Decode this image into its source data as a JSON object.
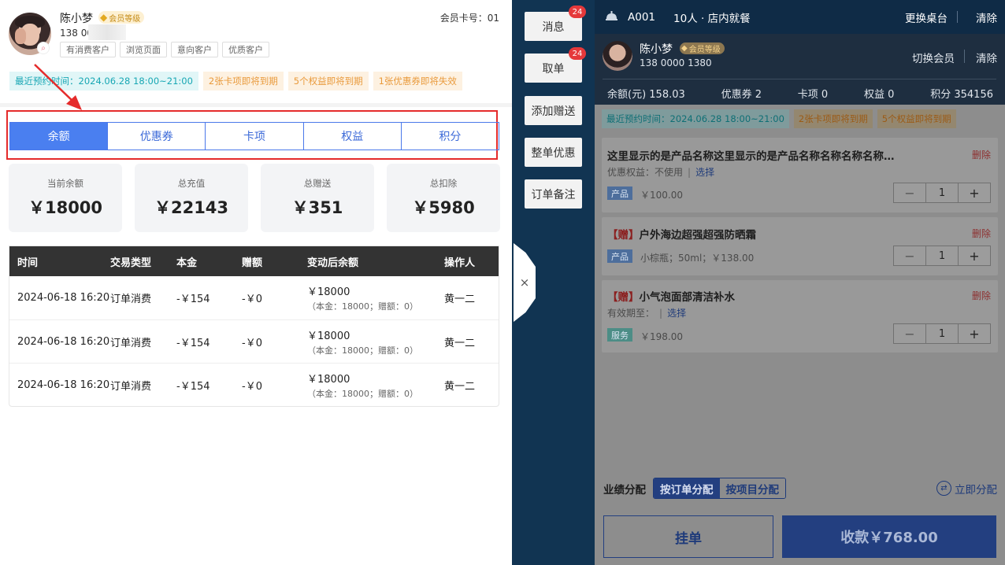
{
  "member": {
    "name": "陈小梦",
    "badge": "会员等级",
    "phone_prefix": "138 00",
    "card_label": "会员卡号：01",
    "tags": [
      "有消费客户",
      "浏览页面",
      "意向客户",
      "优质客户"
    ],
    "notices": [
      "最近预约时间：2024.06.28 18:00~21:00",
      "2张卡项即将到期",
      "5个权益即将到期",
      "1张优惠券即将失效"
    ]
  },
  "tabs": [
    {
      "label": "余额",
      "active": true
    },
    {
      "label": "优惠券",
      "active": false
    },
    {
      "label": "卡项",
      "active": false
    },
    {
      "label": "权益",
      "active": false
    },
    {
      "label": "积分",
      "active": false
    }
  ],
  "stats": [
    {
      "label": "当前余额",
      "value": "￥18000"
    },
    {
      "label": "总充值",
      "value": "￥22143"
    },
    {
      "label": "总赠送",
      "value": "￥351"
    },
    {
      "label": "总扣除",
      "value": "￥5980"
    }
  ],
  "table": {
    "headers": [
      "时间",
      "交易类型",
      "本金",
      "赠额",
      "变动后余额",
      "操作人"
    ],
    "rows": [
      {
        "time": "2024-06-18 16:20",
        "type": "订单消费",
        "principal": "-￥154",
        "gift": "-￥0",
        "balance": "￥18000",
        "balance_sub": "（本金：18000；赠额：0）",
        "operator": "黄一二"
      },
      {
        "time": "2024-06-18 16:20",
        "type": "订单消费",
        "principal": "-￥154",
        "gift": "-￥0",
        "balance": "￥18000",
        "balance_sub": "（本金：18000；赠额：0）",
        "operator": "黄一二"
      },
      {
        "time": "2024-06-18 16:20",
        "type": "订单消费",
        "principal": "-￥154",
        "gift": "-￥0",
        "balance": "￥18000",
        "balance_sub": "（本金：18000；赠额：0）",
        "operator": "黄一二"
      }
    ]
  },
  "strip": {
    "buttons": [
      {
        "label": "消息",
        "badge": "24"
      },
      {
        "label": "取单",
        "badge": "24"
      },
      {
        "label": "添加赠送",
        "badge": ""
      },
      {
        "label": "整单优惠",
        "badge": ""
      },
      {
        "label": "订单备注",
        "badge": ""
      }
    ],
    "close": "×"
  },
  "right": {
    "table_no": "A001",
    "guests": "10人 · 店内就餐",
    "change_table": "更换桌台",
    "clear": "清除",
    "member": {
      "name": "陈小梦",
      "badge": "会员等级",
      "phone": "138 0000 1380",
      "switch": "切换会员",
      "clear": "清除"
    },
    "summary": [
      "余额(元) 158.03",
      "优惠券 2",
      "卡项 0",
      "权益 0",
      "积分 354156"
    ],
    "notices": [
      "最近预约时间：2024.06.28 18:00~21:00",
      "2张卡项即将到期",
      "5个权益即将到期"
    ],
    "items": [
      {
        "gift": "",
        "title": "这里显示的是产品名称这里显示的是产品名称名称名称名称…",
        "delete": "删除",
        "sub_label": "优惠权益：不使用",
        "sub_pick": "选择",
        "tag": "产品",
        "price": "￥100.00",
        "qty": "1"
      },
      {
        "gift": "【赠】",
        "title": "户外海边超强超强防晒霜",
        "delete": "删除",
        "sub_label": "",
        "sub_pick": "",
        "tag": "产品",
        "price": "小棕瓶；50ml；￥138.00",
        "qty": "1"
      },
      {
        "gift": "【赠】",
        "title": "小气泡面部清洁补水",
        "delete": "删除",
        "sub_label": "有效期至：",
        "sub_pick": "选择",
        "tag": "服务",
        "price": "￥198.00",
        "qty": "1"
      }
    ],
    "perf": {
      "label": "业绩分配",
      "by_order": "按订单分配",
      "by_item": "按项目分配",
      "instant": "立即分配"
    },
    "hang": "挂单",
    "pay": "收款￥768.00"
  },
  "colors": {
    "accent": "#4a7ff0",
    "alert": "#e52b2b",
    "dark_navy": "#113452"
  }
}
